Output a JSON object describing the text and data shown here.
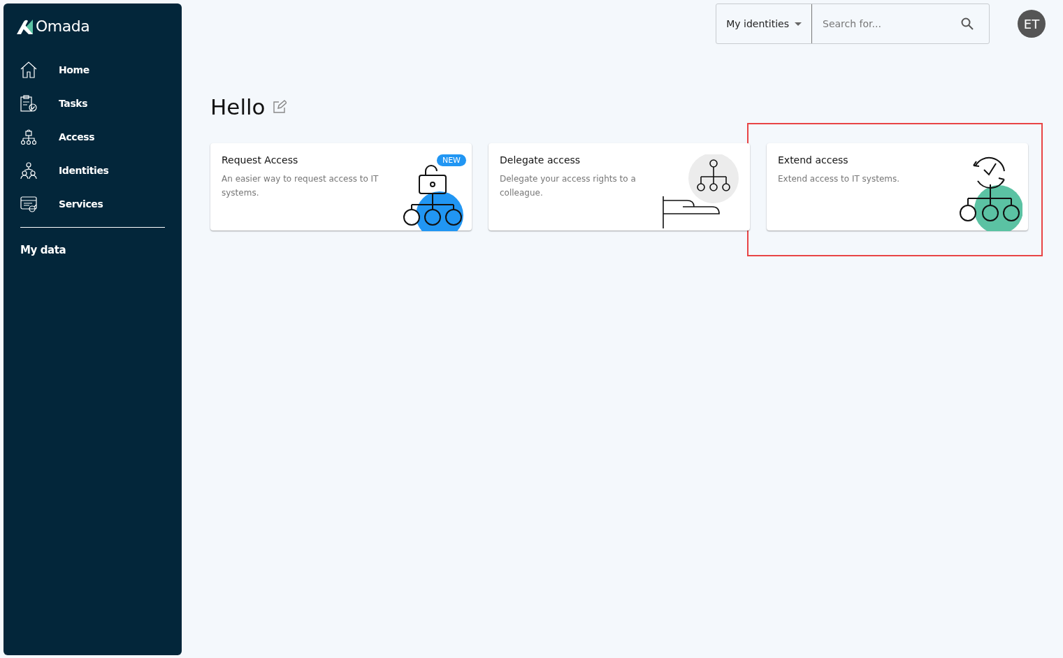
{
  "brand": {
    "name": "Omada"
  },
  "sidebar": {
    "items": [
      {
        "label": "Home",
        "kind": "home"
      },
      {
        "label": "Tasks",
        "kind": "tasks"
      },
      {
        "label": "Access",
        "kind": "access"
      },
      {
        "label": "Identities",
        "kind": "identities"
      },
      {
        "label": "Services",
        "kind": "services"
      }
    ],
    "footer_link": "My data"
  },
  "topbar": {
    "scope": "My identities",
    "search": {
      "placeholder": "Search for..."
    },
    "avatar": "ET"
  },
  "greeting": "Hello",
  "cards": [
    {
      "title": "Request Access",
      "description": "An easier way to request access to IT systems.",
      "kind": "request",
      "badge": "NEW",
      "highlighted": false
    },
    {
      "title": "Delegate access",
      "description": "Delegate your access rights to a colleague.",
      "kind": "delegate",
      "highlighted": false
    },
    {
      "title": "Extend access",
      "description": "Extend access to IT systems.",
      "kind": "extend",
      "highlighted": true
    }
  ]
}
